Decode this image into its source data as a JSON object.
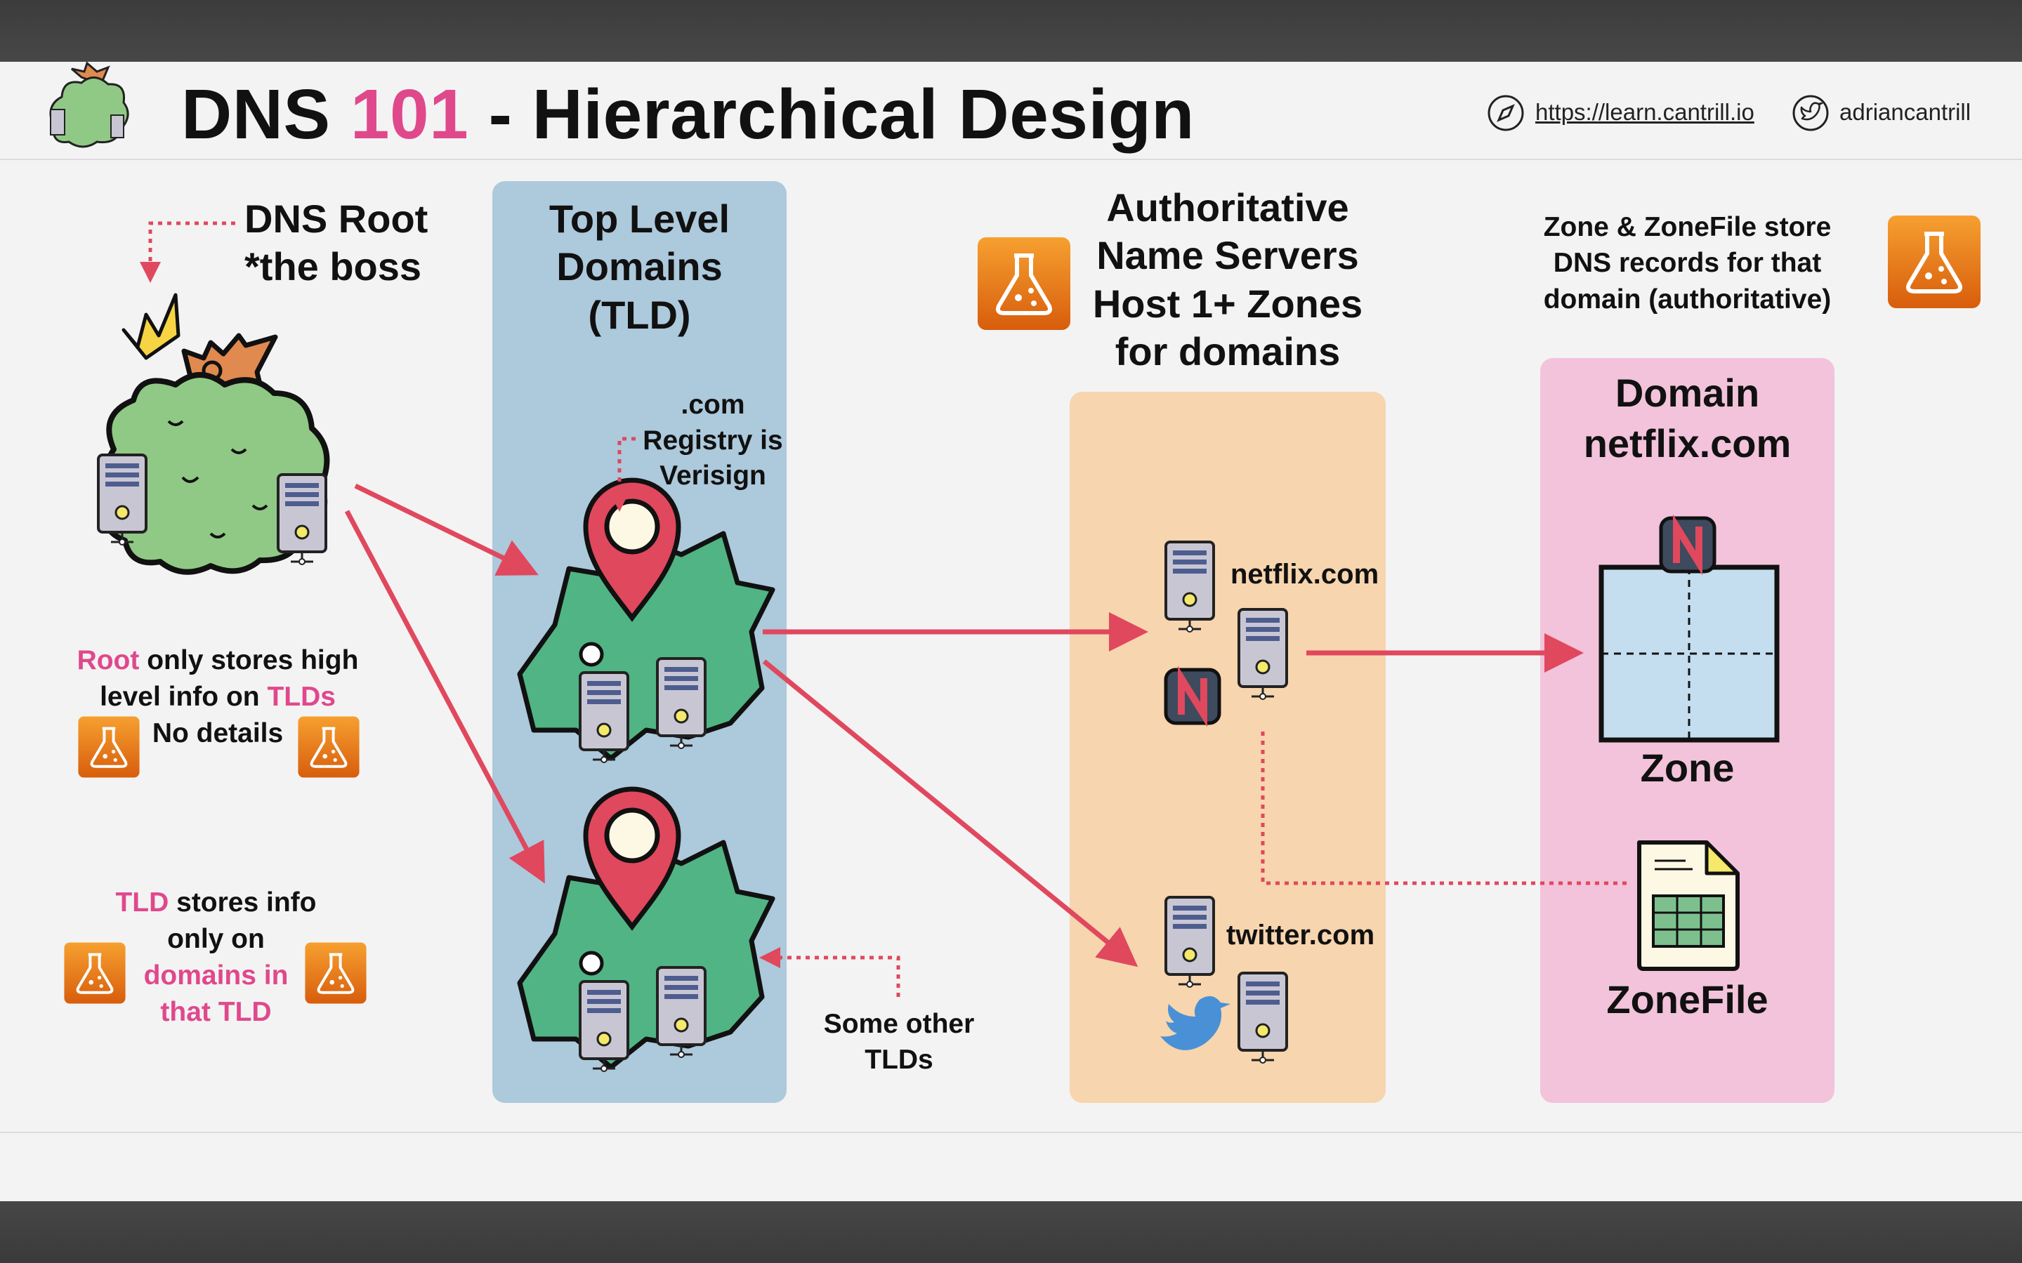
{
  "header": {
    "title_prefix": "DNS ",
    "title_number": "101",
    "title_suffix": " - Hierarchical Design",
    "website": "https://learn.cantrill.io",
    "twitter_handle": "adriancantrill",
    "icons": [
      "tree-server-logo-icon",
      "compass-icon",
      "twitter-icon"
    ]
  },
  "root": {
    "label_line1": "DNS Root",
    "label_line2": "*the boss",
    "note_part1": "Root",
    "note_part2": " only stores high",
    "note_part3": "level info on ",
    "note_part4": "TLDs",
    "note_part5": "No details"
  },
  "tld": {
    "panel_line1": "Top Level",
    "panel_line2": "Domains",
    "panel_line3": "(TLD)",
    "registry_line1": ".com",
    "registry_line2": "Registry is",
    "registry_line3": "Verisign",
    "other_line1": "Some other",
    "other_line2": "TLDs",
    "note_part1": "TLD",
    "note_part2": " stores info",
    "note_part3": "only on",
    "note_part4": "domains in",
    "note_part5": "that TLD"
  },
  "authoritative": {
    "heading_line1": "Authoritative",
    "heading_line2": "Name Servers",
    "heading_line3": "Host 1+ Zones",
    "heading_line4": "for domains",
    "server1": "netflix.com",
    "server2": "twitter.com"
  },
  "zone": {
    "note_line1": "Zone & ZoneFile store",
    "note_line2": "DNS records for that",
    "note_line3": "domain (authoritative)",
    "panel_line1": "Domain",
    "panel_line2": "netflix.com",
    "zone_label": "Zone",
    "zonefile_label": "ZoneFile"
  },
  "colors": {
    "accent_pink": "#e0488c",
    "arrow_red": "#e0485e",
    "tld_panel": "#adc9dc",
    "auth_panel": "#f7d5ae",
    "zone_panel": "#f2c3da",
    "lab_orange": "#f08a1e"
  }
}
